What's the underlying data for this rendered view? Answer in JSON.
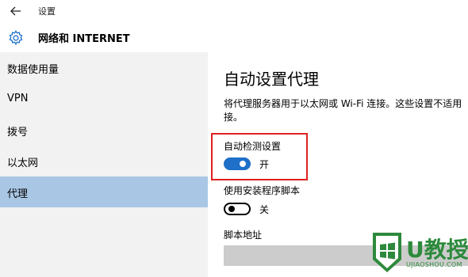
{
  "app": {
    "title": "设置"
  },
  "header": {
    "title": "网络和 INTERNET"
  },
  "sidebar": {
    "items": [
      {
        "label": "数据使用量"
      },
      {
        "label": "VPN"
      },
      {
        "label": "拨号"
      },
      {
        "label": "以太网"
      },
      {
        "label": "代理",
        "selected": true
      }
    ],
    "selected_color": "#a9c7e5"
  },
  "content": {
    "section_title": "自动设置代理",
    "description_line1": "将代理服务器用于以太网或 Wi-Fi 连接。这些设置不适用",
    "description_line2": "接。",
    "auto_detect": {
      "label": "自动检测设置",
      "state": "开",
      "on": true
    },
    "use_script": {
      "label": "使用安装程序脚本",
      "state": "关",
      "on": false
    },
    "script_address": {
      "label": "脚本地址",
      "value": ""
    }
  },
  "watermark": {
    "brand": "U教授",
    "url": "UJIAOSHOU.COM"
  },
  "colors": {
    "toggle_on": "#1e70c8",
    "highlight": "#e02020",
    "watermark": "#2d8a3c"
  },
  "icons": {
    "back": "back-arrow-icon",
    "settings": "gear-icon"
  }
}
